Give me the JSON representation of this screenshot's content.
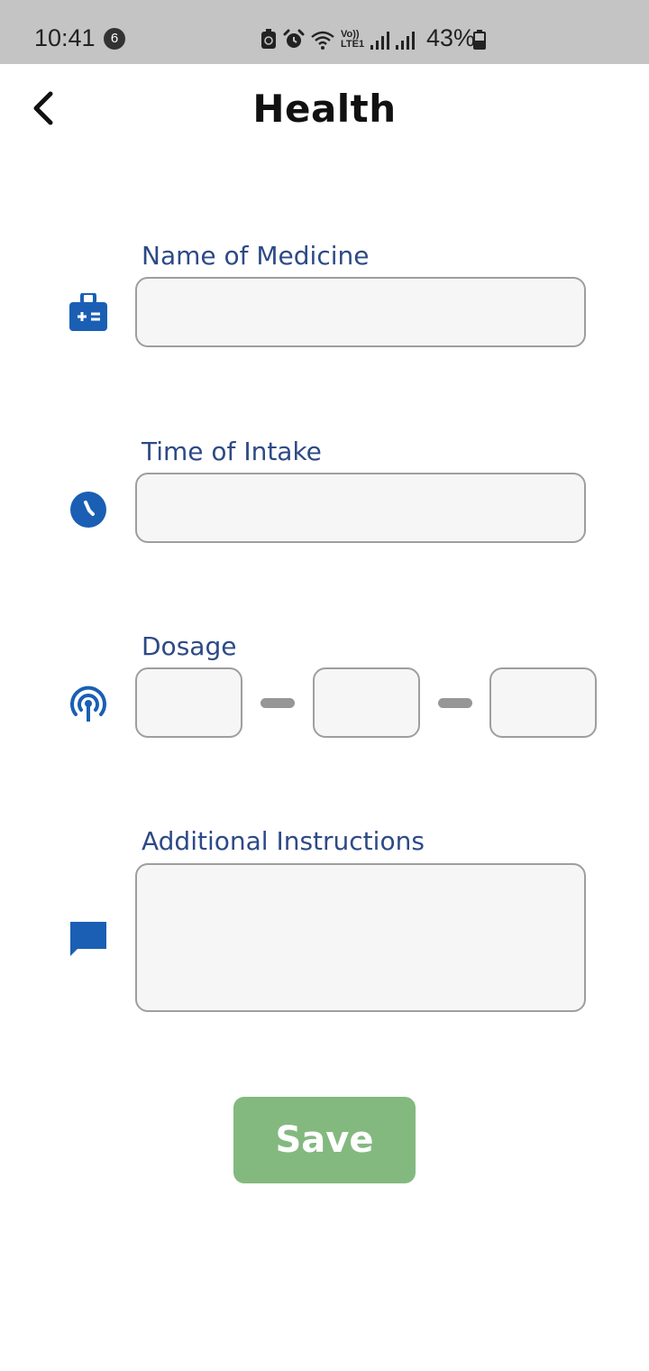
{
  "status_bar": {
    "time": "10:41",
    "notification_count": "6",
    "battery_percent": "43%",
    "icons": [
      "recycle-icon",
      "alarm-icon",
      "wifi-icon",
      "volte-icon",
      "signal-icon",
      "signal-icon",
      "battery-icon"
    ],
    "volte_text_top": "Vo))",
    "volte_text_bottom": "LTE1"
  },
  "header": {
    "title": "Health",
    "back_icon": "chevron-left-icon"
  },
  "form": {
    "medicine_label": "Name of Medicine",
    "medicine_value": "",
    "time_label": "Time of Intake",
    "time_value": "",
    "dosage_label": "Dosage",
    "dosage_values": [
      "",
      "",
      ""
    ],
    "instructions_label": "Additional Instructions",
    "instructions_value": ""
  },
  "icons": {
    "medicine": "medical-bag-icon",
    "time": "clock-icon",
    "dosage": "antenna-icon",
    "instructions": "chat-bubble-icon"
  },
  "actions": {
    "save_label": "Save"
  },
  "colors": {
    "accent_blue": "#1a5fb4",
    "label_blue": "#2d4a86",
    "save_green": "#83b97f",
    "field_bg": "#f6f6f6",
    "field_border": "#9e9e9e"
  }
}
